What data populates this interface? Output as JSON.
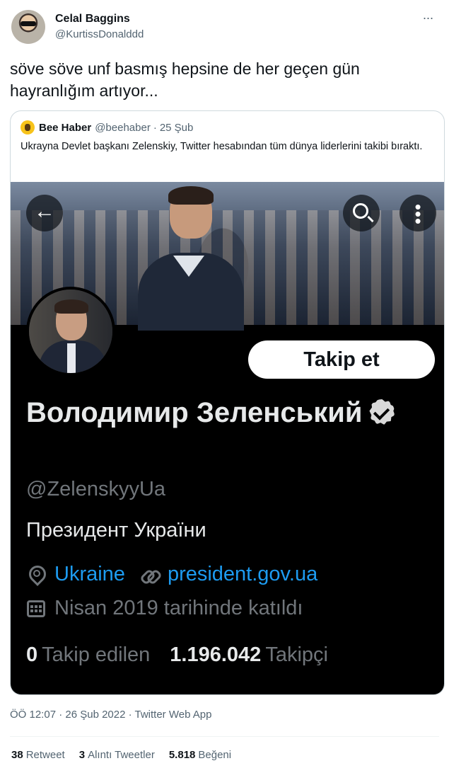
{
  "author": {
    "name": "Celal Baggins",
    "handle": "@KurtissDonalddd"
  },
  "tweet": {
    "text": "söve söve unf basmış hepsine de her geçen gün hayranlığım artıyor...",
    "timestamp": "ÖÖ 12:07 · 26 Şub 2022 · Twitter Web App"
  },
  "quoted": {
    "name": "Bee Haber",
    "handle": "@beehaber",
    "dot": "·",
    "date": "25 Şub",
    "text": "Ukrayna Devlet başkanı Zelenskiy, Twitter hesabından tüm dünya liderlerini takibi bıraktı."
  },
  "profile": {
    "name": "Володимир Зеленський",
    "handle": "@ZelenskyyUa",
    "bio": "Президент України",
    "location": "Ukraine",
    "website": "president.gov.ua",
    "joined": "Nisan 2019 tarihinde katıldı",
    "follow_label": "Takip et",
    "back_glyph": "←",
    "following_count": "0",
    "following_label": "Takip edilen",
    "followers_count": "1.196.042",
    "followers_label": "Takipçi"
  },
  "engagement": {
    "retweets": "38",
    "retweets_label": "Retweet",
    "quotes": "3",
    "quotes_label": "Alıntı Tweetler",
    "likes": "5.818",
    "likes_label": "Beğeni"
  },
  "icons": [
    "avatar",
    "more-icon",
    "back-arrow-icon",
    "search-icon",
    "more-vertical-icon",
    "verified-icon",
    "location-pin-icon",
    "link-icon",
    "calendar-icon"
  ],
  "colors": {
    "link_blue": "#1d9bf0",
    "secondary_text": "#536471",
    "dark_bg": "#000000"
  }
}
